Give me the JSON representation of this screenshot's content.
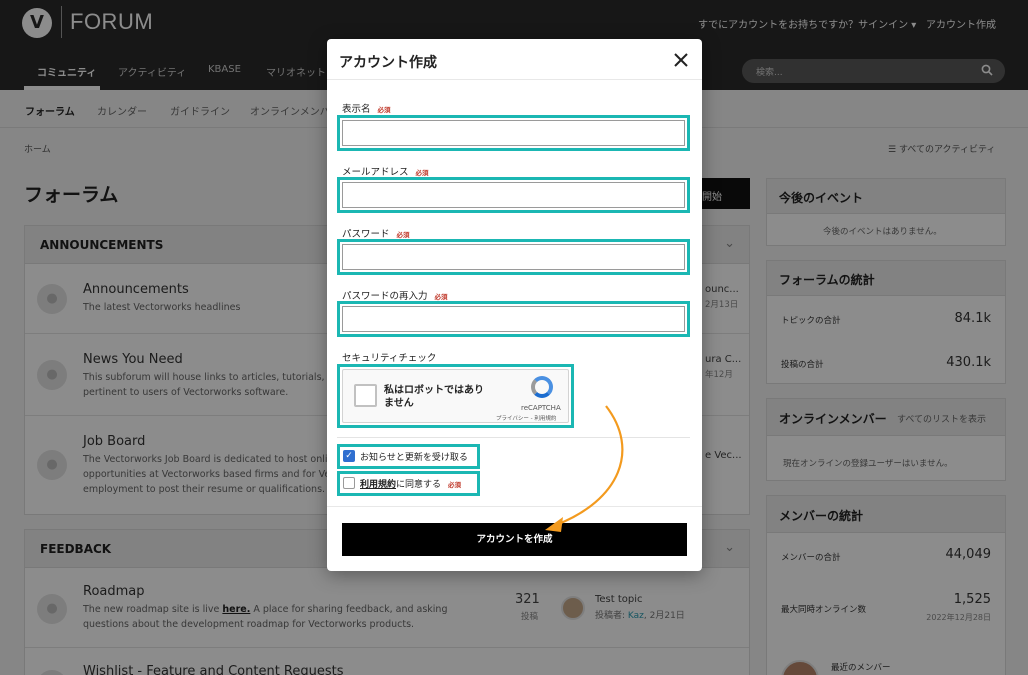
{
  "header": {
    "logo_letter": "V",
    "logo_text": "FORUM",
    "signin_text": "すでにアカウントをお持ちですか？サインイン ▾",
    "create_account": "アカウント作成",
    "search_placeholder": "検索...",
    "search_icon": "magnifier-icon"
  },
  "nav": {
    "items": [
      "コミュニティ",
      "アクティビティ",
      "KBASE",
      "マリオネット"
    ]
  },
  "subnav": {
    "items": [
      "フォーラム",
      "カレンダー",
      "ガイドライン",
      "オンラインメンバ"
    ]
  },
  "breadcrumb": "ホーム",
  "all_activity": "すべてのアクティビティ",
  "page_title": "フォーラム",
  "start_button": "開始",
  "announcements": {
    "title": "ANNOUNCEMENTS",
    "forums": [
      {
        "title": "Announcements",
        "desc": "The latest Vectorworks headlines",
        "frag1": "ounc...",
        "frag2": "2月13日"
      },
      {
        "title": "News You Need",
        "desc1": "This subforum will house links to articles, tutorials, te",
        "desc2": "pertinent to users of Vectorworks software.",
        "frag1": "ura C...",
        "frag2": "年12月"
      },
      {
        "title": "Job Board",
        "desc1": "The Vectorworks Job Board is dedicated to host onlin",
        "desc2": "opportunities at Vectorworks based firms and for Vec",
        "desc3": "employment to post their resume or qualifications.",
        "frag1": "e Vec..."
      }
    ]
  },
  "feedback": {
    "title": "FEEDBACK",
    "forums": [
      {
        "title": "Roadmap",
        "desc_pre": "The new roadmap site is live ",
        "desc_link": "here.",
        "desc_post": " A place for sharing feedback, and asking",
        "desc2": "questions about the development roadmap for Vectorworks products.",
        "count": "321",
        "count_label": "投稿",
        "topic": "Test topic",
        "by_pre": "投稿者: ",
        "by_user": "Kaz",
        "by_date": ", 2月21日"
      },
      {
        "title": "Wishlist - Feature and Content Requests"
      }
    ]
  },
  "sidebar": {
    "events": {
      "title": "今後のイベント",
      "empty": "今後のイベントはありません。"
    },
    "forum_stats": {
      "title": "フォーラムの統計",
      "topics_label": "トピックの合計",
      "topics_value": "84.1k",
      "posts_label": "投稿の合計",
      "posts_value": "430.1k"
    },
    "online": {
      "title": "オンラインメンバー",
      "link": "すべてのリストを表示",
      "empty": "現在オンラインの登録ユーザーはいません。"
    },
    "member_stats": {
      "title": "メンバーの統計",
      "total_label": "メンバーの合計",
      "total_value": "44,049",
      "max_label": "最大同時オンライン数",
      "max_value": "1,525",
      "max_date": "2022年12月28日",
      "recent_label": "最近のメンバー"
    }
  },
  "modal": {
    "title": "アカウント作成",
    "close_icon": "close-icon",
    "required": "必須",
    "fields": [
      {
        "label": "表示名",
        "value": ""
      },
      {
        "label": "メールアドレス",
        "value": ""
      },
      {
        "label": "パスワード",
        "value": ""
      },
      {
        "label": "パスワードの再入力",
        "value": ""
      }
    ],
    "security_label": "セキュリティチェック",
    "captcha_text": "私はロボットではありません",
    "captcha_brand": "reCAPTCHA",
    "captcha_links": "プライバシー - 利用規約",
    "newsletter_label": "お知らせと更新を受け取る",
    "terms_link": "利用規約",
    "terms_rest": "に同意する",
    "submit": "アカウントを作成"
  },
  "colors": {
    "highlight": "#1bb7b3",
    "arrow": "#f39a1e",
    "checkbox": "#2f6fd0"
  }
}
